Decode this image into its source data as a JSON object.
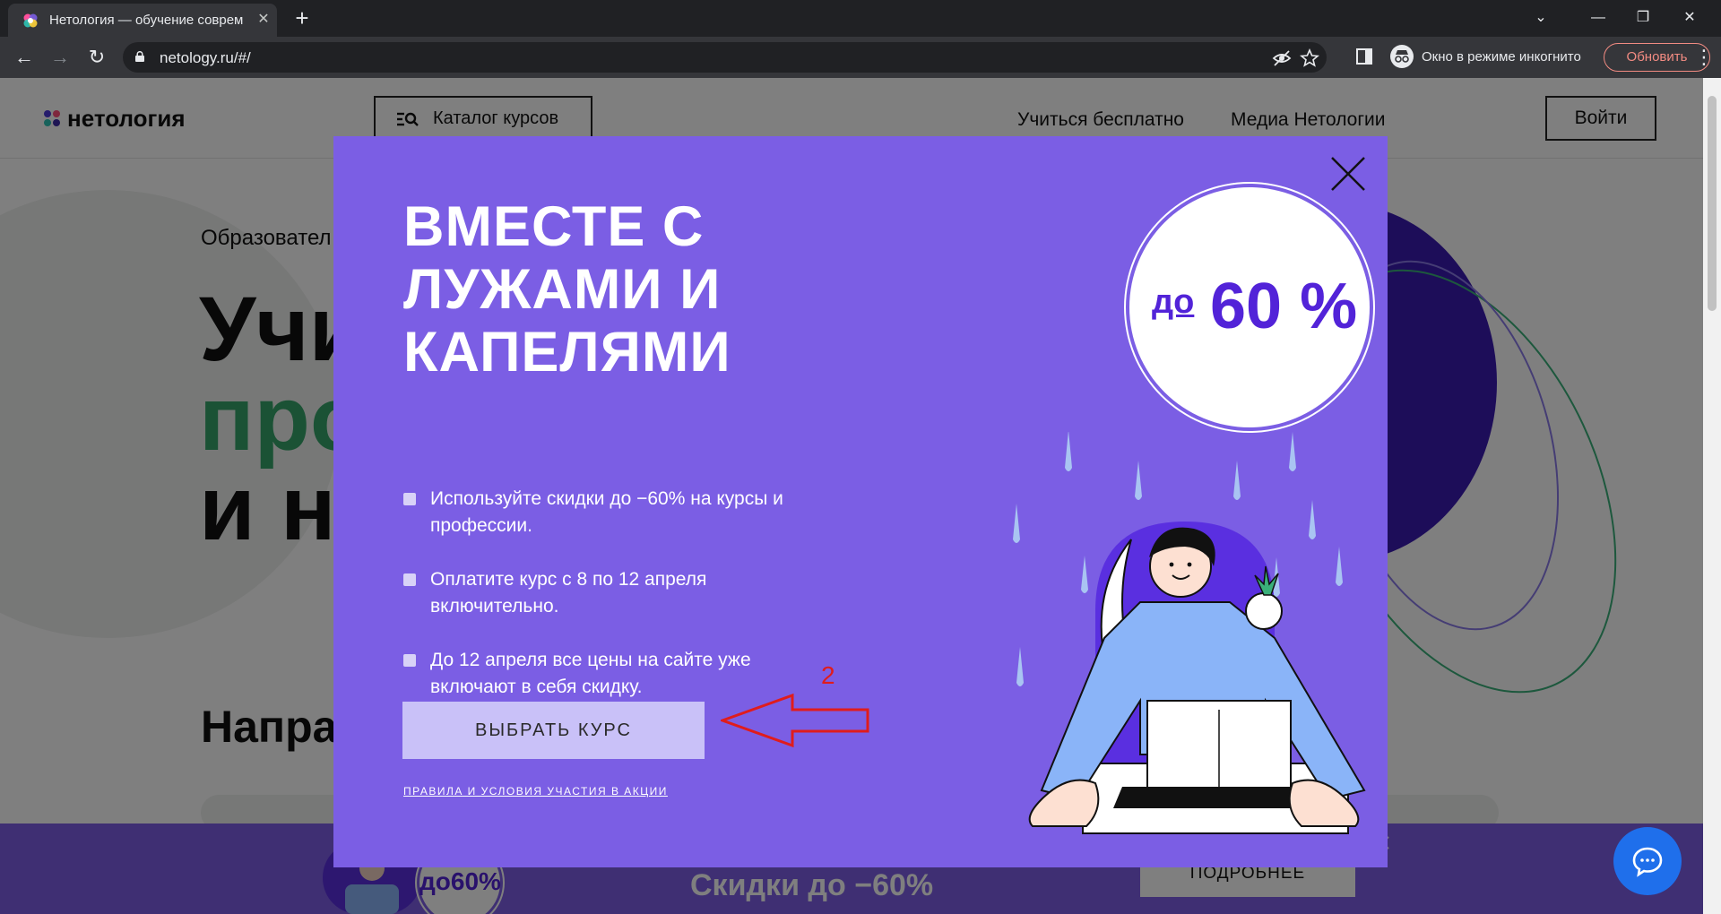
{
  "browser": {
    "tab_title": "Нетология — обучение соврем",
    "url": "netology.ru/#/",
    "incognito_label": "Окно в режиме инкогнито",
    "update_button": "Обновить"
  },
  "site": {
    "logo_text": "нетология",
    "catalog_button": "Каталог курсов",
    "nav_links": [
      "Учиться бесплатно",
      "Медиа Нетологии"
    ],
    "login_button": "Войти",
    "hero_subtitle": "Образовател",
    "hero_lines": [
      "Учи",
      "про",
      "и н"
    ],
    "section_heading": "Напра"
  },
  "banner": {
    "badge_text": "до60%",
    "text": "Скидки до −60%",
    "button": "ПОДРОБНЕЕ"
  },
  "modal": {
    "title_lines": [
      "ВМЕСТЕ С",
      "ЛУЖАМИ И",
      "КАПЕЛЯМИ"
    ],
    "bullets": [
      "Используйте скидки до −60% на курсы и профессии.",
      "Оплатите курс с 8 по 12 апреля включительно.",
      "До 12 апреля все цены на сайте уже включают в себя скидку."
    ],
    "cta_button": "ВЫБРАТЬ КУРС",
    "rules_link": "ПРАВИЛА И УСЛОВИЯ УЧАСТИЯ В АКЦИИ",
    "discount_prefix": "до",
    "discount_value": "60 %"
  },
  "annotation": {
    "number": "2",
    "color": "#e01c1c"
  },
  "colors": {
    "modal_bg": "#7b5ee4",
    "accent_purple": "#5223d8",
    "cta_bg": "#c9c1f8",
    "hero_green": "#37a56b"
  }
}
